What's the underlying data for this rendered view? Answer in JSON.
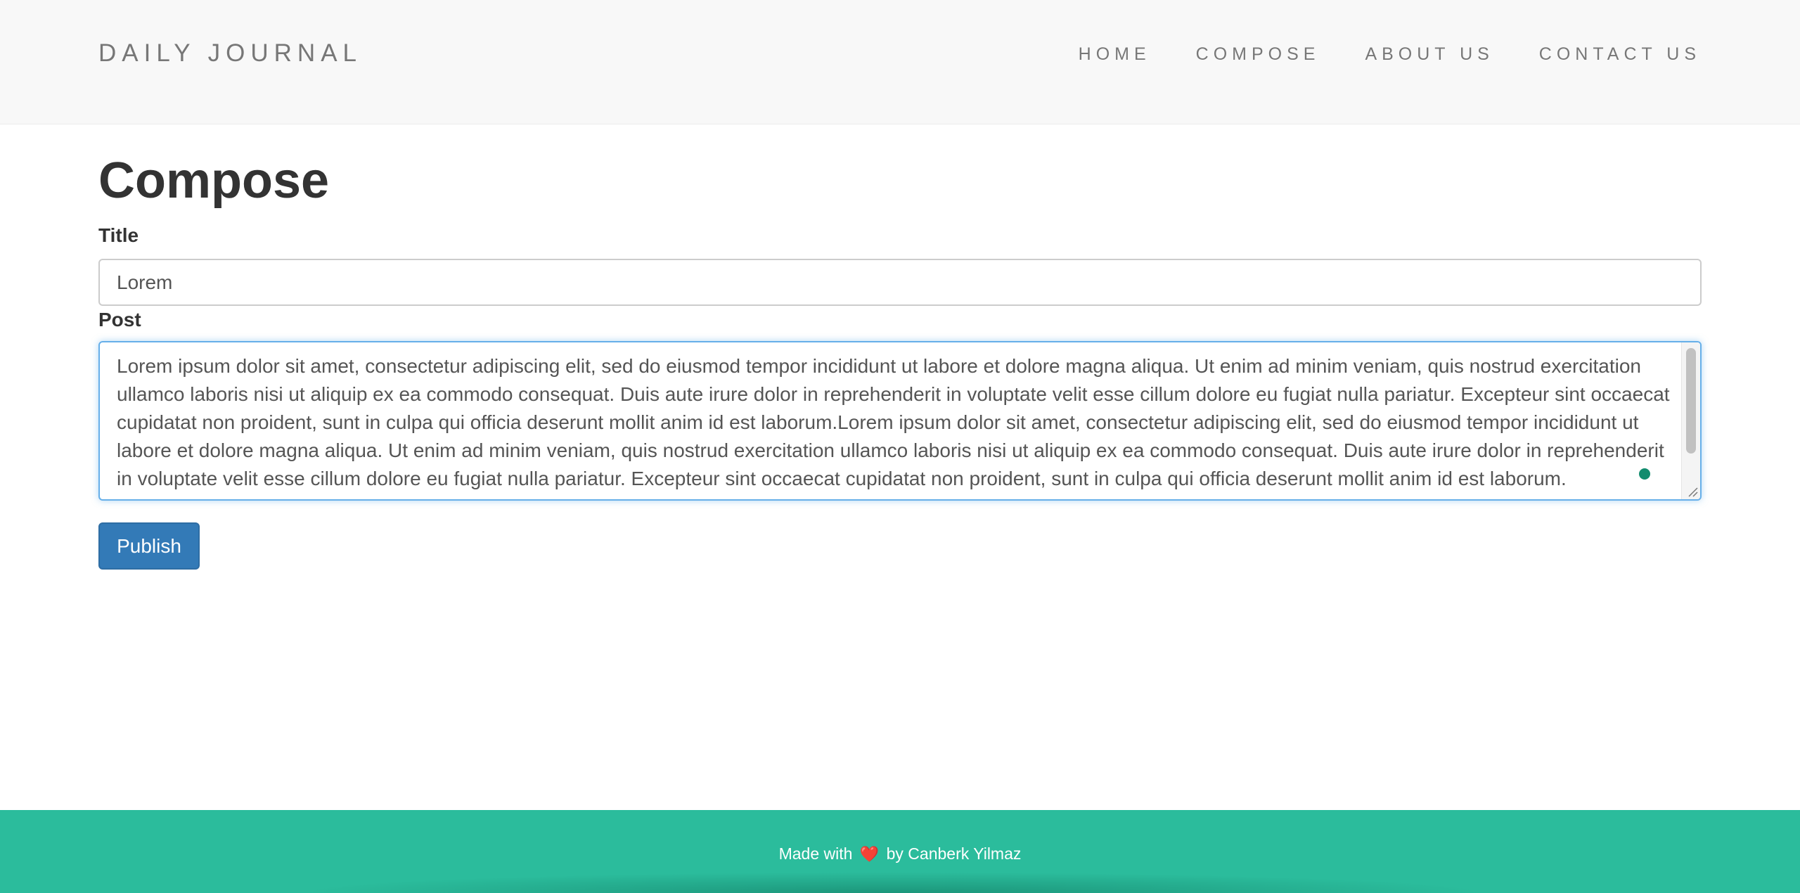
{
  "brand": "DAILY JOURNAL",
  "nav": {
    "items": [
      {
        "label": "HOME"
      },
      {
        "label": "COMPOSE"
      },
      {
        "label": "ABOUT US"
      },
      {
        "label": "CONTACT US"
      }
    ]
  },
  "page": {
    "heading": "Compose"
  },
  "form": {
    "title_label": "Title",
    "title_value": "Lorem",
    "post_label": "Post",
    "post_value": "Lorem ipsum dolor sit amet, consectetur adipiscing elit, sed do eiusmod tempor incididunt ut labore et dolore magna aliqua. Ut enim ad minim veniam, quis nostrud exercitation ullamco laboris nisi ut aliquip ex ea commodo consequat. Duis aute irure dolor in reprehenderit in voluptate velit esse cillum dolore eu fugiat nulla pariatur. Excepteur sint occaecat cupidatat non proident, sunt in culpa qui officia deserunt mollit anim id est laborum.Lorem ipsum dolor sit amet, consectetur adipiscing elit, sed do eiusmod tempor incididunt ut labore et dolore magna aliqua. Ut enim ad minim veniam, quis nostrud exercitation ullamco laboris nisi ut aliquip ex ea commodo consequat. Duis aute irure dolor in reprehenderit in voluptate velit esse cillum dolore eu fugiat nulla pariatur. Excepteur sint occaecat cupidatat non proident, sunt in culpa qui officia deserunt mollit anim id est laborum.",
    "publish_label": "Publish"
  },
  "footer": {
    "prefix": "Made with",
    "heart": "❤️",
    "suffix": "by Canberk Yilmaz"
  },
  "colors": {
    "navbar_bg": "#f8f8f8",
    "primary_button": "#337ab7",
    "footer_bg": "#2bbc9c",
    "focus_border": "#66afe9",
    "status_dot": "#128c6e"
  }
}
